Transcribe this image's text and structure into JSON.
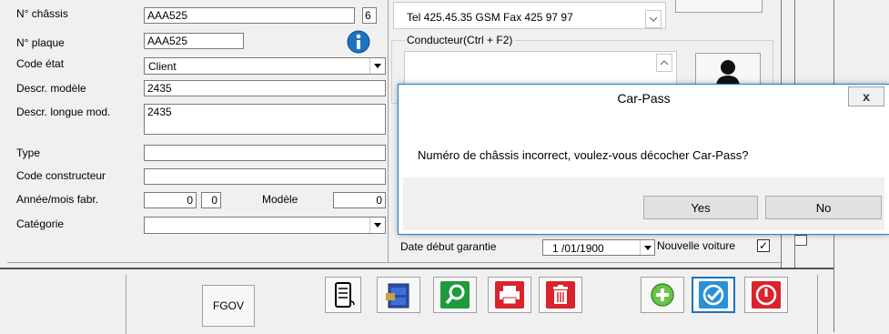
{
  "form": {
    "chassis_label": "N° châssis",
    "chassis_value": "AAA525",
    "chassis_check": "6",
    "plaque_label": "N° plaque",
    "plaque_value": "AAA525",
    "code_etat_label": "Code état",
    "code_etat_value": "Client",
    "descr_modele_label": "Descr. modèle",
    "descr_modele_value": "2435",
    "descr_longue_label": "Descr. longue mod.",
    "descr_longue_value": "2435",
    "type_label": "Type",
    "type_value": "",
    "code_constructeur_label": "Code constructeur",
    "code_constructeur_value": "",
    "annee_mois_label": "Année/mois fabr.",
    "annee_value": "0",
    "mois_value": "0",
    "modele_label": "Modèle",
    "modele_value": "0",
    "categorie_label": "Catégorie",
    "categorie_value": ""
  },
  "right_panel": {
    "contact_text": "Tel 425.45.35 GSM  Fax 425 97 97",
    "conducteur_label": "Conducteur(Ctrl + F2)",
    "date_garantie_label": "Date début garantie",
    "date_garantie_value": "1 /01/1900",
    "nouvelle_voiture_label": "Nouvelle voiture",
    "nouvelle_voiture_checked": "✓"
  },
  "toolbar": {
    "fgov_label": "FGOV"
  },
  "dialog": {
    "title": "Car-Pass",
    "close_glyph": "x",
    "message": "Numéro de châssis incorrect, voulez-vous décocher Car-Pass?",
    "yes_label": "Yes",
    "no_label": "No"
  },
  "colors": {
    "dialog_border": "#1883d7",
    "accent_blue": "#1e73be",
    "toolbar_green": "#1e9a3c",
    "toolbar_red": "#d9232d"
  }
}
